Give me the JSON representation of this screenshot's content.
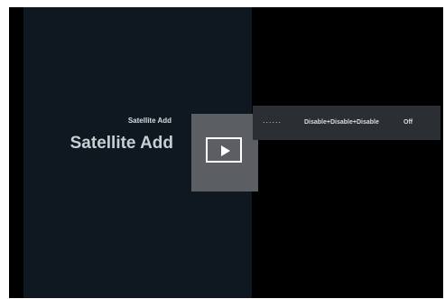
{
  "panel": {
    "small_title": "Satellite Add",
    "big_title": "Satellite Add"
  },
  "media": {
    "play_icon": "play-icon"
  },
  "settings": {
    "dots": "......",
    "value": "Disable+Disable+Disable",
    "state": "Off"
  }
}
